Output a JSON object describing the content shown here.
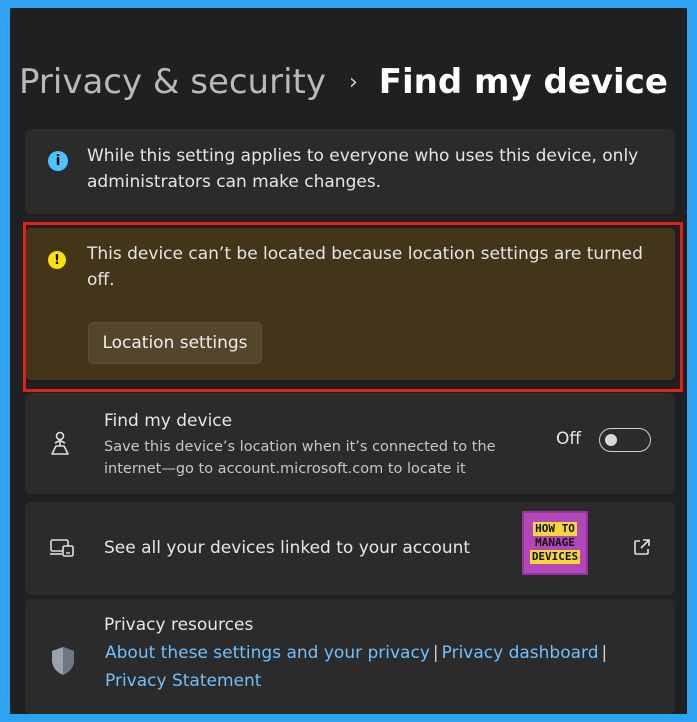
{
  "breadcrumb": {
    "parent": "Privacy & security",
    "separator": "›",
    "current": "Find my device"
  },
  "info_banner": {
    "icon": "info-icon",
    "text": "While this setting applies to everyone who uses this device, only administrators can make changes."
  },
  "warning_banner": {
    "icon": "warning-icon",
    "text": "This device can’t be located because location settings are turned off.",
    "button_label": "Location settings",
    "highlight_color": "#e0201c"
  },
  "find_my_device": {
    "icon": "person-pin-icon",
    "title": "Find my device",
    "description": "Save this device’s location when it’s connected to the internet—go to account.microsoft.com to locate it",
    "toggle_label": "Off",
    "toggle_on": false
  },
  "linked_devices": {
    "icon": "devices-icon",
    "label": "See all your devices linked to your account",
    "logo_lines": [
      "HOW TO",
      "MANAGE",
      "DEVICES"
    ],
    "external_icon": "open-external-icon"
  },
  "privacy_resources": {
    "icon": "shield-icon",
    "title": "Privacy resources",
    "links": [
      "About these settings and your privacy",
      "Privacy dashboard",
      "Privacy Statement"
    ],
    "separator": "|"
  },
  "colors": {
    "page_border": "#2ea3f2",
    "background": "#202020",
    "card": "#2b2b2b",
    "warning_card": "#433519",
    "link": "#6fc0ff",
    "info_icon": "#4cc2ff",
    "warning_icon": "#fce100"
  }
}
